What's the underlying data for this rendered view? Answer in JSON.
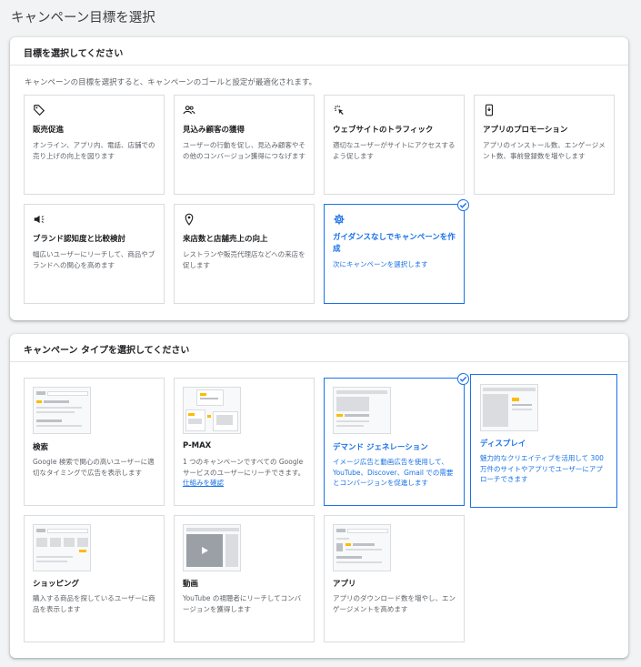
{
  "page_title": "キャンペーン目標を選択",
  "goal_section": {
    "heading": "目標を選択してください",
    "description": "キャンペーンの目標を選択すると、キャンペーンのゴールと設定が最適化されます。",
    "cards": [
      {
        "title": "販売促進",
        "desc": "オンライン、アプリ内、電話、店舗での売り上げの向上を図ります",
        "icon": "tag-icon"
      },
      {
        "title": "見込み顧客の獲得",
        "desc": "ユーザーの行動を促し、見込み顧客やその他のコンバージョン獲得につなげます",
        "icon": "people-icon"
      },
      {
        "title": "ウェブサイトのトラフィック",
        "desc": "適切なユーザーがサイトにアクセスするよう促します",
        "icon": "cursor-click-icon"
      },
      {
        "title": "アプリのプロモーション",
        "desc": "アプリのインストール数、エンゲージメント数、事前登録数を増やします",
        "icon": "phone-icon"
      },
      {
        "title": "ブランド認知度と比較検討",
        "desc": "幅広いユーザーにリーチして、商品やブランドへの関心を高めます",
        "icon": "megaphone-icon"
      },
      {
        "title": "来店数と店舗売上の向上",
        "desc": "レストランや販売代理店などへの来店を促します",
        "icon": "location-pin-icon"
      },
      {
        "title": "ガイダンスなしでキャンペーンを作成",
        "desc": "次にキャンペーンを選択します",
        "icon": "gear-icon",
        "selected": true
      }
    ]
  },
  "type_section": {
    "heading": "キャンペーン タイプを選択してください",
    "cards": [
      {
        "title": "検索",
        "desc": "Google 検索で関心の高いユーザーに適切なタイミングで広告を表示します"
      },
      {
        "title": "P-MAX",
        "desc": "1 つのキャンペーンですべての Google サービスのユーザーにリーチできます。",
        "link": "仕組みを確認"
      },
      {
        "title": "デマンド ジェネレーション",
        "desc": "イメージ広告と動画広告を使用して、YouTube、Discover、Gmail での需要とコンバージョンを促進します",
        "selected": true
      },
      {
        "title": "ディスプレイ",
        "desc": "魅力的なクリエイティブを活用して 300 万件のサイトやアプリでユーザーにアプローチできます",
        "highlighted": true
      },
      {
        "title": "ショッピング",
        "desc": "購入する商品を探しているユーザーに商品を表示します"
      },
      {
        "title": "動画",
        "desc": "YouTube の視聴者にリーチしてコンバージョンを獲得します"
      },
      {
        "title": "アプリ",
        "desc": "アプリのダウンロード数を増やし、エンゲージメントを高めます"
      }
    ]
  },
  "colors": {
    "accent": "#1a73e8",
    "thumb_yellow": "#fbbc04"
  }
}
